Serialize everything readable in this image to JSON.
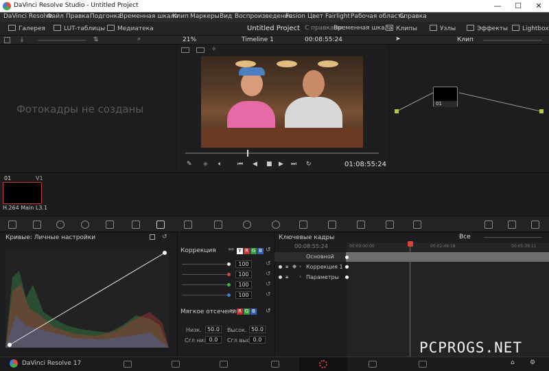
{
  "window": {
    "title": "DaVinci Resolve Studio - Untitled Project",
    "min": "—",
    "max": "☐",
    "close": "✕"
  },
  "menu": [
    "DaVinci Resolve",
    "Файл",
    "Правка",
    "Подгонка",
    "Временная шкала",
    "Клип",
    "Маркеры",
    "Вид",
    "Воспроизведение",
    "Fusion",
    "Цвет",
    "Fairlight",
    "Рабочая область",
    "Справка"
  ],
  "toolbar": {
    "gallery": "Галерея",
    "lut": "LUT-таблицы",
    "media": "Медиатека",
    "project_title": "Untitled Project",
    "edited": "С правками",
    "timeline": "Временная шкала",
    "clips": "Клипы",
    "nodes": "Узлы",
    "effects": "Эффекты",
    "lightbox": "Lightbox"
  },
  "viewer": {
    "zoom": "21%",
    "timeline_name": "Timeline 1",
    "duration": "00:08:55:24",
    "timecode": "01:08:55:24"
  },
  "gallery": {
    "empty_text": "Фотокадры не созданы"
  },
  "nodes": {
    "mode": "Клип",
    "node_label": "01"
  },
  "clip": {
    "index": "01",
    "track": "V1",
    "codec": "H.264 Main L3.1"
  },
  "curves": {
    "title": "Кривые: Личные настройки"
  },
  "correction": {
    "title": "Коррекция",
    "channels": [
      "Y",
      "R",
      "G",
      "B"
    ],
    "values": [
      "100",
      "100",
      "100",
      "100"
    ],
    "soft_clip": "Мягкое отсечение",
    "low_label": "Низк.",
    "low": "50.0",
    "high_label": "Высок.",
    "high": "50.0",
    "low_soft_label": "Сгл низ",
    "low_soft": "0.0",
    "high_soft_label": "Сгл выс",
    "high_soft": "0.0"
  },
  "keyframes": {
    "title": "Ключевые кадры",
    "filter": "Все",
    "time": "00:08:55:24",
    "ruler": [
      "00:00:00:00",
      "00:02:49:18",
      "00:05:39:11"
    ],
    "rows": [
      "Основной",
      "Коррекция 1",
      "Параметры"
    ]
  },
  "bottom": {
    "app": "DaVinci Resolve 17"
  },
  "watermark": "PCPROGS.NET",
  "colors": {
    "accent_red": "#d9453b",
    "panel": "#1d1d1f"
  }
}
